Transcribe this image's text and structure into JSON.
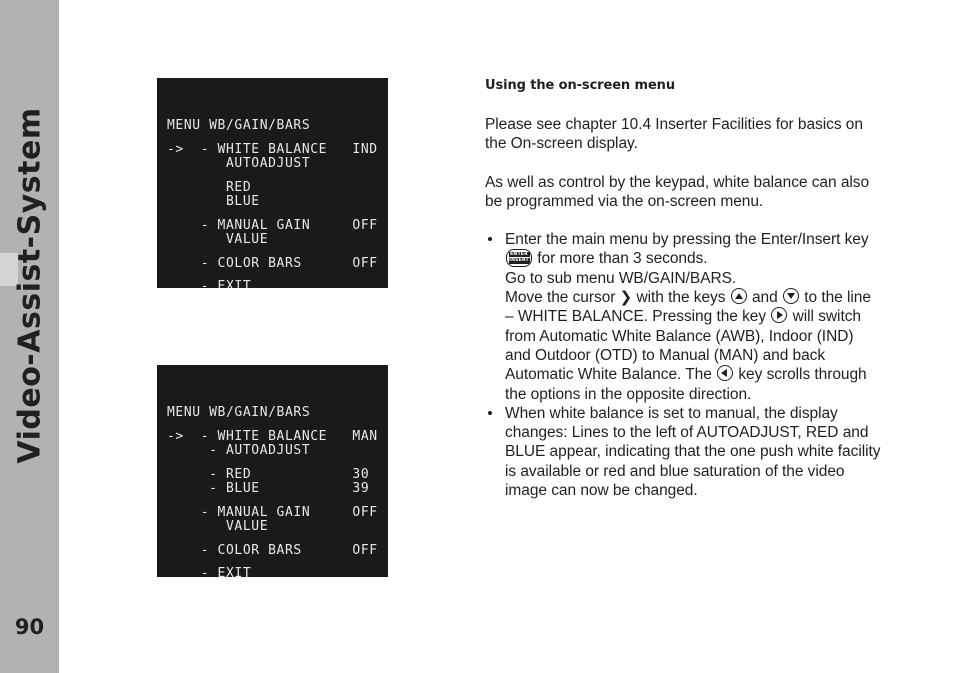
{
  "sidebar": {
    "title": "Video-Assist-System",
    "page_number": "90",
    "tab_color": "#d4d4d4",
    "bg_color": "#b2b2b2"
  },
  "osd_menus": [
    {
      "name": "wb-gain-bars-indoor",
      "title": "MENU WB/GAIN/BARS",
      "bg_color": "#1a191c",
      "text_color": "#e8e8e8",
      "lines": [
        "MENU WB/GAIN/BARS",
        "",
        "->  - WHITE BALANCE   IND",
        "       AUTOADJUST",
        "",
        "       RED",
        "       BLUE",
        "",
        "    - MANUAL GAIN     OFF",
        "       VALUE",
        "",
        "    - COLOR BARS      OFF",
        "",
        "    - EXIT"
      ]
    },
    {
      "name": "wb-gain-bars-manual",
      "title": "MENU WB/GAIN/BARS",
      "bg_color": "#1a191c",
      "text_color": "#e8e8e8",
      "lines": [
        "MENU WB/GAIN/BARS",
        "",
        "->  - WHITE BALANCE   MAN",
        "     - AUTOADJUST",
        "",
        "     - RED            30",
        "     - BLUE           39",
        "",
        "    - MANUAL GAIN     OFF",
        "       VALUE",
        "",
        "    - COLOR BARS      OFF",
        "",
        "    - EXIT"
      ]
    }
  ],
  "content": {
    "heading": "Using the on-screen menu",
    "paragraph_1": "Please see chapter 10.4 Inserter Facilities for basics on the On-screen display.",
    "paragraph_2": "As well as control by the keypad, white balance can also be programmed via the on-screen menu.",
    "bullet_1": {
      "part_1": "Enter the main menu by pressing the Enter/Insert key",
      "enter_key_line_1": "ENTER",
      "enter_key_line_2": "INSERT",
      "part_2": "for more than 3 seconds.",
      "part_3": "Go to sub menu WB/GAIN/BARS.",
      "part_4": "Move the cursor",
      "cursor_glyph": "❯",
      "part_5": "with the keys",
      "part_6": "and",
      "part_7": "to the line",
      "part_8": "– WHITE BALANCE. Pressing the key",
      "part_9": "will switch",
      "part_10": "from Automatic White Balance (AWB), Indoor (IND)",
      "part_11": "and Outdoor (OTD) to Manual (MAN) and back",
      "part_12": "Automatic White Balance. The",
      "part_13": "key scrolls through",
      "part_14": "the options in the opposite direction."
    },
    "bullet_2": {
      "text": "When white balance is set to manual, the display changes: Lines to the left of AUTOADJUST, RED and BLUE appear, indicating that the one push white facility is available or red and blue saturation of the video image can now be changed."
    }
  }
}
